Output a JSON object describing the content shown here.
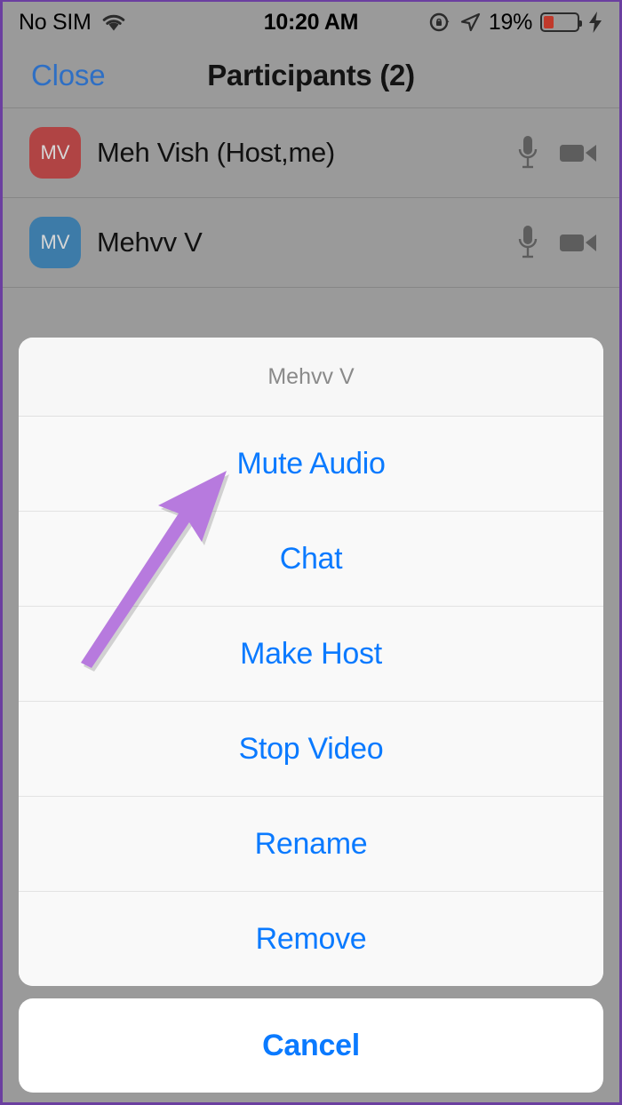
{
  "status_bar": {
    "carrier": "No SIM",
    "wifi_icon": "wifi-icon",
    "time": "10:20 AM",
    "rotation_lock_icon": "rotation-lock-icon",
    "location_icon": "location-arrow-icon",
    "battery_percent": "19%",
    "battery_level": 19,
    "battery_color": "#c0392b",
    "charging_icon": "lightning-bolt-icon"
  },
  "nav": {
    "close_label": "Close",
    "title": "Participants (2)",
    "close_color": "#2e6fc4"
  },
  "participants": [
    {
      "initials": "MV",
      "name": "Meh Vish (Host,me)",
      "avatar_color": "#b04444",
      "mic_icon": "microphone-icon",
      "video_icon": "video-camera-icon"
    },
    {
      "initials": "MV",
      "name": "Mehvv V",
      "avatar_color": "#3d7ba8",
      "mic_icon": "microphone-icon",
      "video_icon": "video-camera-icon"
    }
  ],
  "action_sheet": {
    "header": "Mehvv V",
    "items": [
      {
        "label": "Mute Audio"
      },
      {
        "label": "Chat"
      },
      {
        "label": "Make Host"
      },
      {
        "label": "Stop Video"
      },
      {
        "label": "Rename"
      },
      {
        "label": "Remove"
      }
    ],
    "cancel_label": "Cancel",
    "accent_color": "#0a7aff"
  },
  "annotation": {
    "arrow_color": "#b77ade",
    "points_to": "Mute Audio"
  }
}
